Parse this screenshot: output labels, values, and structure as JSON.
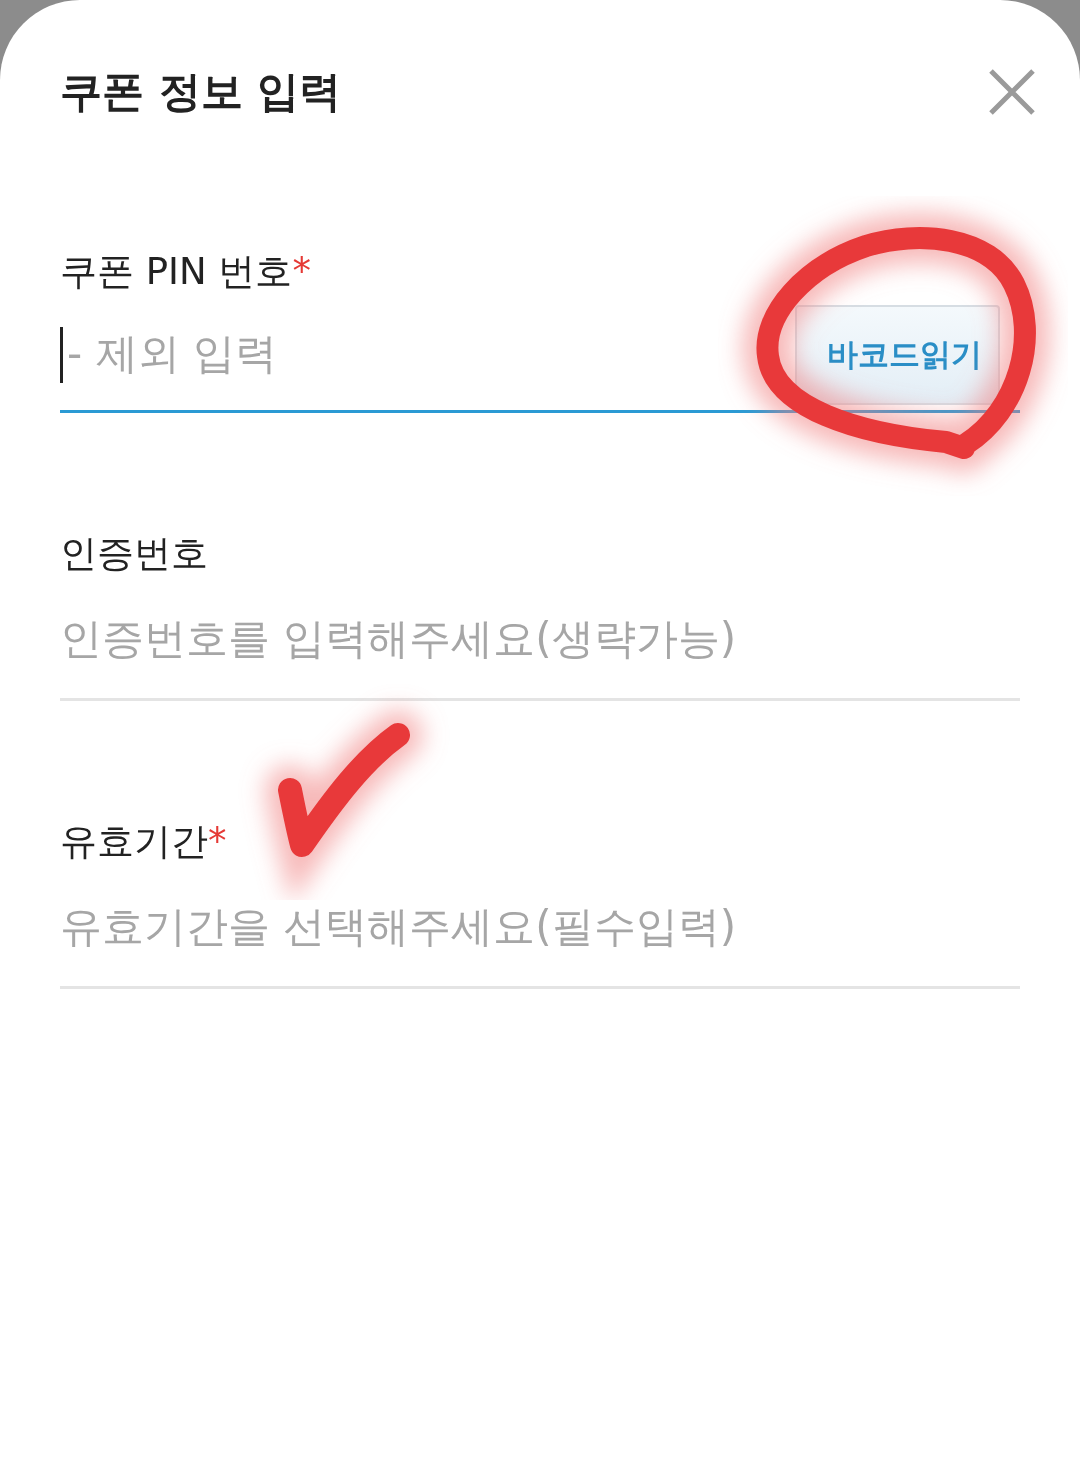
{
  "sheet": {
    "title": "쿠폰 정보 입력"
  },
  "fields": [
    {
      "label": "쿠폰 PIN 번호",
      "mark": "*",
      "placeholder": "- 제외 입력",
      "focused": true,
      "button": "바코드읽기"
    },
    {
      "label": "인증번호",
      "placeholder": "인증번호를 입력해주세요(생략가능)",
      "focused": false
    },
    {
      "label": "유효기간",
      "mark": "*",
      "placeholder": "유효기간을 선택해주세요(필수입력)",
      "focused": false
    }
  ]
}
